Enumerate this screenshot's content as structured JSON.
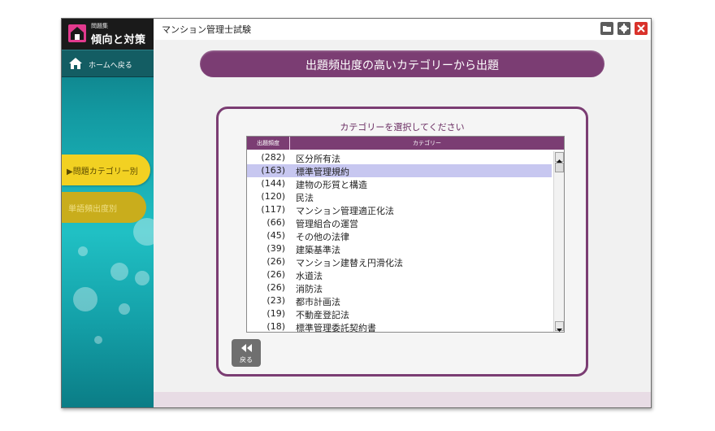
{
  "brand": {
    "small_label": "問題集",
    "title": "傾向と対策"
  },
  "sidebar": {
    "home_label": "ホームへ戻る",
    "items": [
      {
        "label": "▶問題カテゴリー別"
      },
      {
        "label": "単語頻出度別"
      }
    ]
  },
  "window": {
    "title": "マンション管理士試験"
  },
  "main": {
    "banner": "出題頻出度の高いカテゴリーから出題",
    "panel_title": "カテゴリーを選択してください",
    "columns": {
      "freq": "出題頻度",
      "category": "カテゴリー"
    },
    "rows": [
      {
        "freq": "(282)",
        "category": "区分所有法"
      },
      {
        "freq": "(163)",
        "category": "標準管理規約"
      },
      {
        "freq": "(144)",
        "category": "建物の形質と構造"
      },
      {
        "freq": "(120)",
        "category": "民法"
      },
      {
        "freq": "(117)",
        "category": "マンション管理適正化法"
      },
      {
        "freq": "(66)",
        "category": "管理組合の運営"
      },
      {
        "freq": "(45)",
        "category": "その他の法律"
      },
      {
        "freq": "(39)",
        "category": "建築基準法"
      },
      {
        "freq": "(26)",
        "category": "マンション建替え円滑化法"
      },
      {
        "freq": "(26)",
        "category": "水道法"
      },
      {
        "freq": "(26)",
        "category": "消防法"
      },
      {
        "freq": "(23)",
        "category": "都市計画法"
      },
      {
        "freq": "(19)",
        "category": "不動産登記法"
      },
      {
        "freq": "(18)",
        "category": "標準管理委託契約書"
      }
    ],
    "selected_category": "標準管理規約",
    "back_label": "戻る"
  },
  "icons": [
    "home-icon",
    "folder-icon",
    "gear-icon",
    "close-icon",
    "rewind-icon",
    "brand-house-icon"
  ],
  "colors": {
    "accent": "#7b3d73",
    "nav_active": "#f2d122",
    "close": "#d9322b"
  }
}
